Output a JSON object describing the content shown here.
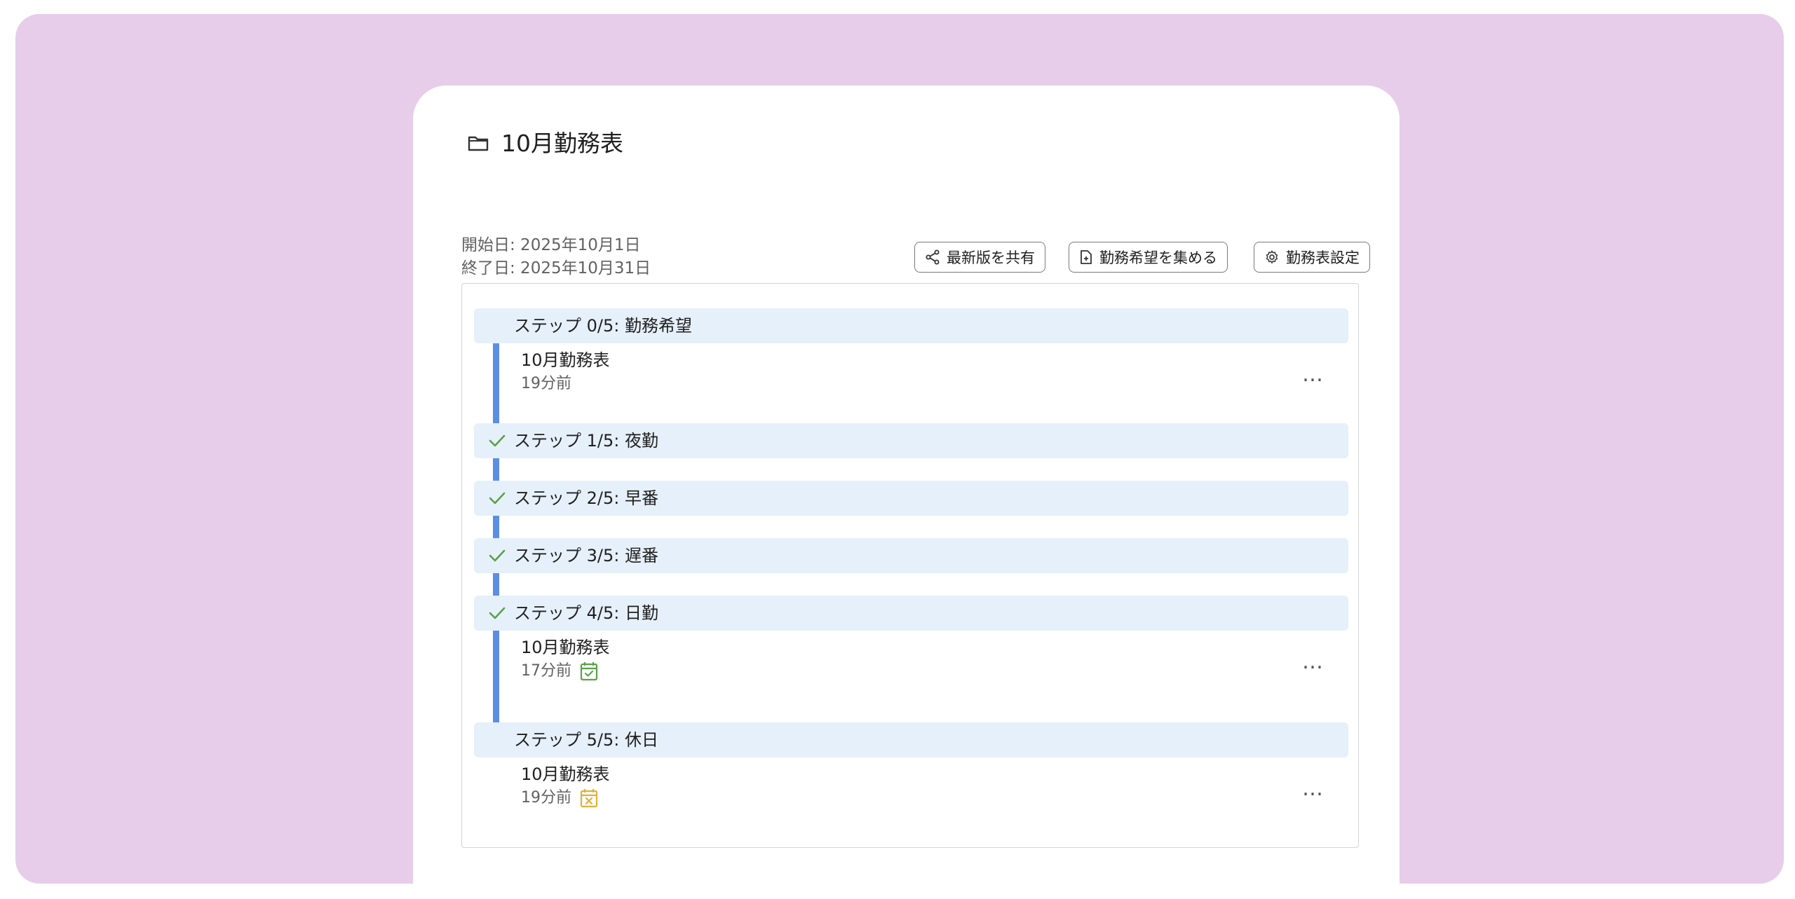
{
  "header": {
    "title": "10月勤務表",
    "folder_icon": "folder-icon"
  },
  "dates": {
    "start": "開始日: 2025年10月1日",
    "end": "終了日: 2025年10月31日"
  },
  "toolbar": {
    "share_label": "最新版を共有",
    "collect_label": "勤務希望を集める",
    "settings_label": "勤務表設定"
  },
  "steps": [
    {
      "label": "ステップ 0/5: 勤務希望",
      "done": false
    },
    {
      "label": "ステップ 1/5: 夜勤",
      "done": true
    },
    {
      "label": "ステップ 2/5: 早番",
      "done": true
    },
    {
      "label": "ステップ 3/5: 遅番",
      "done": true
    },
    {
      "label": "ステップ 4/5: 日勤",
      "done": true
    },
    {
      "label": "ステップ 5/5: 休日",
      "done": false
    }
  ],
  "items": [
    {
      "name": "10月勤務表",
      "time": "19分前",
      "status": "none"
    },
    {
      "name": "10月勤務表",
      "time": "17分前",
      "status": "calendar-check-icon"
    },
    {
      "name": "10月勤務表",
      "time": "19分前",
      "status": "calendar-x-icon"
    }
  ],
  "colors": {
    "background": "#e7cdea",
    "step_band": "#e6f0fb",
    "timeline": "#5b8ee6",
    "check": "#5aa14a",
    "calendar_ok": "#5aa14a",
    "calendar_warn": "#e0b13a"
  }
}
